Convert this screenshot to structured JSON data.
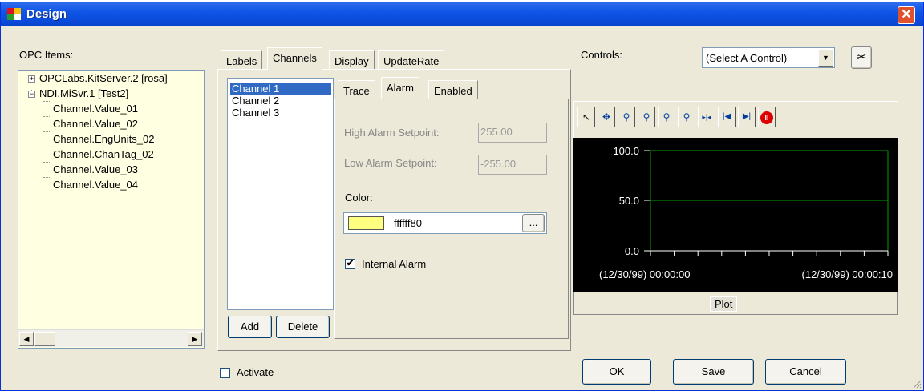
{
  "window": {
    "title": "Design",
    "close_label": "✕"
  },
  "opc": {
    "label": "OPC Items:",
    "tree": [
      {
        "text": "OPCLabs.KitServer.2 [rosa]",
        "expander": "+"
      },
      {
        "text": "NDI.MiSvr.1 [Test2]",
        "expander": "−"
      },
      {
        "text": "Channel.Value_01"
      },
      {
        "text": "Channel.Value_02"
      },
      {
        "text": "Channel.EngUnits_02"
      },
      {
        "text": "Channel.ChanTag_02"
      },
      {
        "text": "Channel.Value_03"
      },
      {
        "text": "Channel.Value_04"
      }
    ]
  },
  "tabs": {
    "main": [
      "Labels",
      "Channels",
      "Display",
      "UpdateRate"
    ],
    "main_active": "Channels",
    "sub": [
      "Trace",
      "Alarm",
      "Enabled"
    ],
    "sub_active": "Alarm"
  },
  "channels": {
    "items": [
      "Channel 1",
      "Channel 2",
      "Channel 3"
    ],
    "selected": "Channel 1",
    "add_label": "Add",
    "delete_label": "Delete"
  },
  "alarm": {
    "high_label": "High Alarm Setpoint:",
    "high_value": "255.00",
    "low_label": "Low Alarm Setpoint:",
    "low_value": "-255.00",
    "color_label": "Color:",
    "color_value": "ffffff80",
    "color_swatch": "#ffff80",
    "browse_label": "...",
    "internal_label": "Internal Alarm",
    "internal_checked": true
  },
  "activate": {
    "label": "Activate",
    "checked": false
  },
  "controls": {
    "label": "Controls:",
    "select_value": "(Select A Control)"
  },
  "toolbar": {
    "icons": [
      "cursor-icon",
      "pan-icon",
      "zoom-in-icon",
      "zoom-out-icon",
      "zoom-box-icon",
      "zoom-reset-icon",
      "split-icon",
      "skip-back-icon",
      "skip-forward-icon",
      "pause-icon"
    ]
  },
  "plot": {
    "y_ticks": [
      "100.0",
      "50.0",
      "0.0"
    ],
    "x_start": "(12/30/99) 00:00:00",
    "x_end": "(12/30/99) 00:00:10",
    "footer_label": "Plot",
    "line_color": "#00a000"
  },
  "buttons": {
    "ok": "OK",
    "save": "Save",
    "cancel": "Cancel"
  }
}
